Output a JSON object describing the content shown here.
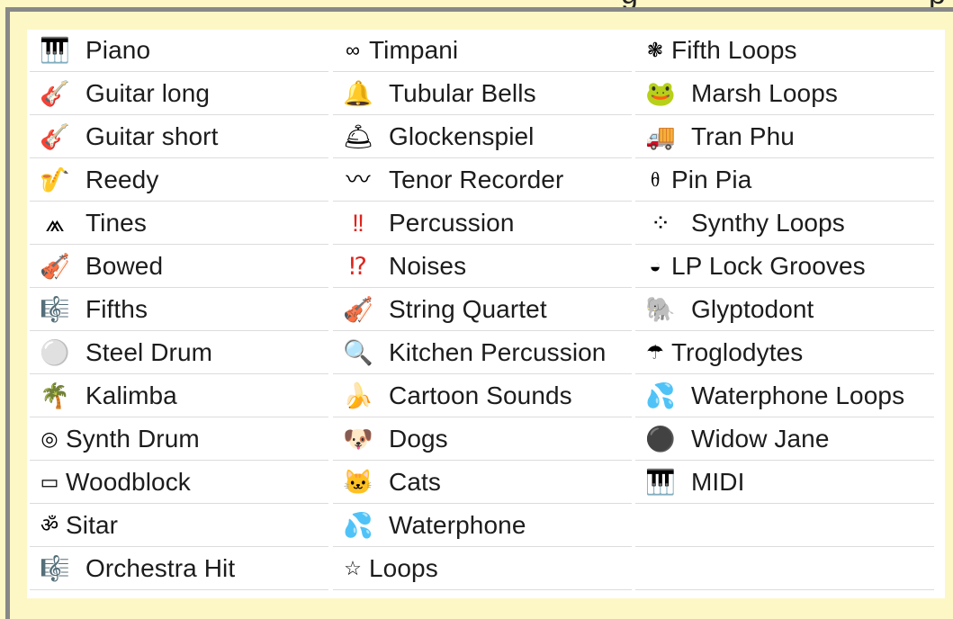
{
  "header_strip": {
    "text_left": "g",
    "text_right": "p"
  },
  "columns": [
    [
      {
        "icon": "piano-keyboard-icon",
        "glyph": "🎹",
        "label": "Piano"
      },
      {
        "icon": "guitar-icon",
        "glyph": "🎸",
        "label": "Guitar long"
      },
      {
        "icon": "guitar-icon",
        "glyph": "🎸",
        "label": "Guitar short"
      },
      {
        "icon": "saxophone-icon",
        "glyph": "🎷",
        "label": "Reedy"
      },
      {
        "icon": "tines-icon",
        "glyph": "⩕",
        "label": "Tines"
      },
      {
        "icon": "violin-icon",
        "glyph": "🎻",
        "label": "Bowed"
      },
      {
        "icon": "musical-score-icon",
        "glyph": "🎼",
        "label": "Fifths"
      },
      {
        "icon": "circle-icon",
        "glyph": "⚪",
        "label": "Steel Drum"
      },
      {
        "icon": "palm-tree-icon",
        "glyph": "🌴",
        "label": "Kalimba"
      },
      {
        "icon": "concentric-circle-icon",
        "glyph": "◎",
        "label": "Synth Drum",
        "small": true
      },
      {
        "icon": "rectangle-icon",
        "glyph": "▭",
        "label": "Woodblock",
        "small": true
      },
      {
        "icon": "om-icon",
        "glyph": "ॐ",
        "label": "Sitar",
        "small": true
      },
      {
        "icon": "musical-score-icon",
        "glyph": "🎼",
        "label": "Orchestra Hit"
      }
    ],
    [
      {
        "icon": "infinity-icon",
        "glyph": "∞",
        "label": "Timpani",
        "small": true
      },
      {
        "icon": "bell-icon",
        "glyph": "🔔",
        "label": "Tubular Bells"
      },
      {
        "icon": "service-bell-icon",
        "glyph": "🛎",
        "label": "Glockenspiel"
      },
      {
        "icon": "wave-icon",
        "glyph": "〰",
        "label": "Tenor Recorder"
      },
      {
        "icon": "double-exclamation-icon",
        "glyph": "‼",
        "label": "Percussion",
        "color": "#e0231c"
      },
      {
        "icon": "interrobang-icon",
        "glyph": "⁉",
        "label": "Noises",
        "color": "#e0231c"
      },
      {
        "icon": "violin-icon",
        "glyph": "🎻",
        "label": "String Quartet"
      },
      {
        "icon": "magnifying-glass-icon",
        "glyph": "🔍",
        "label": "Kitchen Percussion"
      },
      {
        "icon": "banana-icon",
        "glyph": "🍌",
        "label": "Cartoon Sounds"
      },
      {
        "icon": "dog-face-icon",
        "glyph": "🐶",
        "label": "Dogs"
      },
      {
        "icon": "cat-face-icon",
        "glyph": "🐱",
        "label": "Cats"
      },
      {
        "icon": "water-drops-icon",
        "glyph": "💦",
        "label": "Waterphone"
      },
      {
        "icon": "star-outline-icon",
        "glyph": "☆",
        "label": "Loops",
        "small": true
      }
    ],
    [
      {
        "icon": "flower-icon",
        "glyph": "❃",
        "label": "Fifth Loops",
        "small": true
      },
      {
        "icon": "frog-icon",
        "glyph": "🐸",
        "label": "Marsh Loops"
      },
      {
        "icon": "truck-icon",
        "glyph": "🚚",
        "label": "Tran Phu"
      },
      {
        "icon": "small-glyph-icon",
        "glyph": "ᦲ",
        "label": "Pin Pia",
        "small": true
      },
      {
        "icon": "four-dots-icon",
        "glyph": "⁘",
        "label": "Synthy Loops"
      },
      {
        "icon": "half-circle-icon",
        "glyph": "◒",
        "label": "LP Lock Grooves",
        "small": true
      },
      {
        "icon": "elephant-icon",
        "glyph": "🐘",
        "label": "Glyptodont"
      },
      {
        "icon": "umbrella-icon",
        "glyph": "☂",
        "label": "Troglodytes",
        "small": true
      },
      {
        "icon": "water-drops-icon",
        "glyph": "💦",
        "label": "Waterphone Loops"
      },
      {
        "icon": "gray-ball-icon",
        "glyph": "⚫",
        "label": "Widow Jane",
        "color": "#8a9496"
      },
      {
        "icon": "piano-keyboard-icon",
        "glyph": "🎹",
        "label": "MIDI"
      },
      {
        "icon": "",
        "glyph": "",
        "label": ""
      },
      {
        "icon": "",
        "glyph": "",
        "label": ""
      }
    ]
  ]
}
